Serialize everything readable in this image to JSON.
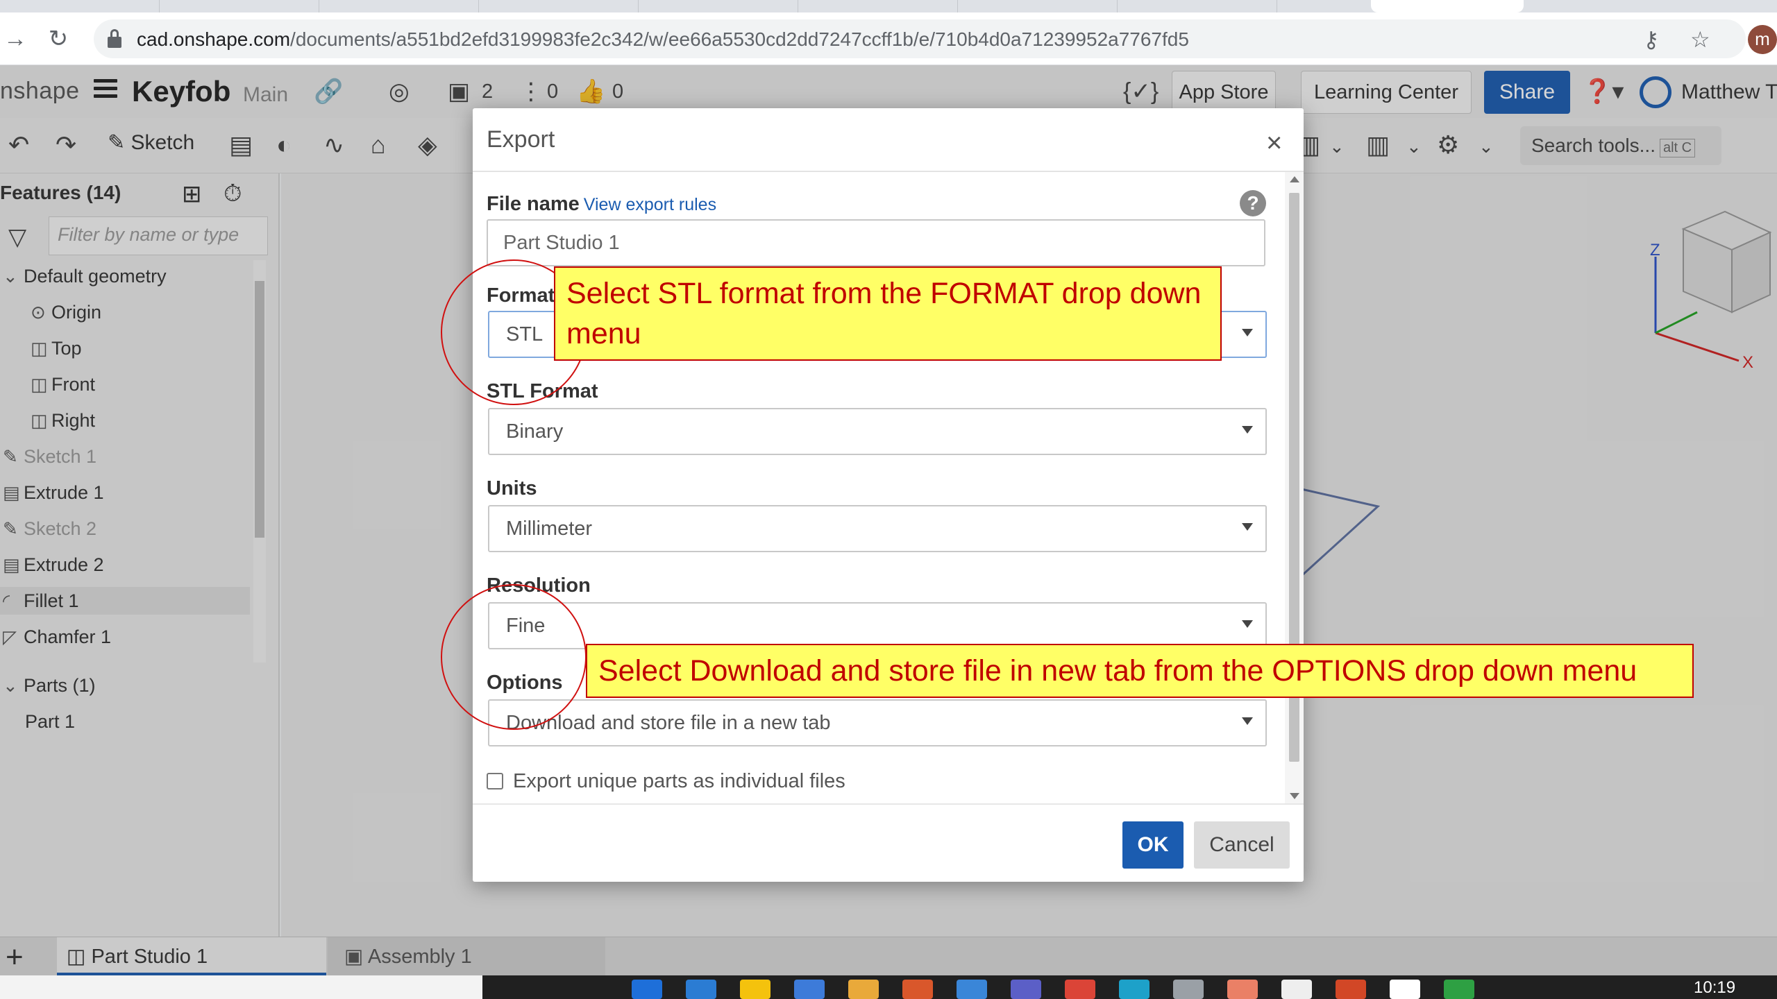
{
  "browser": {
    "url_host": "cad.onshape.com",
    "url_path": "/documents/a551bd2efd3199983fe2c342/w/ee66a5530cd2dd7247ccff1b/e/710b4d0a71239952a7767fd5",
    "profile_initial": "m"
  },
  "header": {
    "brand": "nshape",
    "doc_title": "Keyfob",
    "branch": "Main",
    "versions_count": "2",
    "branches_count": "0",
    "likes_count": "0",
    "app_store_label": "App Store",
    "learning_center_label": "Learning Center",
    "share_label": "Share",
    "user_name": "Matthew Tv"
  },
  "toolbar": {
    "sketch_label": "Sketch",
    "search_label": "Search tools...",
    "search_shortcut": "alt C"
  },
  "features": {
    "title": "Features (14)",
    "filter_placeholder": "Filter by name or type",
    "default_geometry_label": "Default geometry",
    "items": [
      {
        "label": "Origin"
      },
      {
        "label": "Top"
      },
      {
        "label": "Front"
      },
      {
        "label": "Right"
      },
      {
        "label": "Sketch 1"
      },
      {
        "label": "Extrude 1"
      },
      {
        "label": "Sketch 2"
      },
      {
        "label": "Extrude 2"
      },
      {
        "label": "Fillet 1"
      },
      {
        "label": "Chamfer 1"
      }
    ],
    "parts_label": "Parts (1)",
    "part_label": "Part 1"
  },
  "bottom_tabs": {
    "part_studio": "Part Studio 1",
    "assembly": "Assembly 1"
  },
  "taskbar": {
    "clock": "10:19"
  },
  "dialog": {
    "title": "Export",
    "file_name_label": "File name",
    "view_rules_link": "View export rules",
    "file_name_value": "Part Studio 1",
    "format_label": "Format",
    "format_value": "STL",
    "stl_format_label": "STL Format",
    "stl_format_value": "Binary",
    "units_label": "Units",
    "units_value": "Millimeter",
    "resolution_label": "Resolution",
    "resolution_value": "Fine",
    "options_label": "Options",
    "options_value": "Download and store file in a new tab",
    "checkbox_label": "Export unique parts as individual files",
    "ok_label": "OK",
    "cancel_label": "Cancel"
  },
  "annotations": {
    "format_callout": "Select STL format from the FORMAT drop down menu",
    "options_callout": "Select Download and store file in new tab from the OPTIONS drop down menu"
  },
  "colors": {
    "primary_blue": "#1b5cb0",
    "callout_fill": "#ffff66",
    "callout_text": "#c00000"
  }
}
